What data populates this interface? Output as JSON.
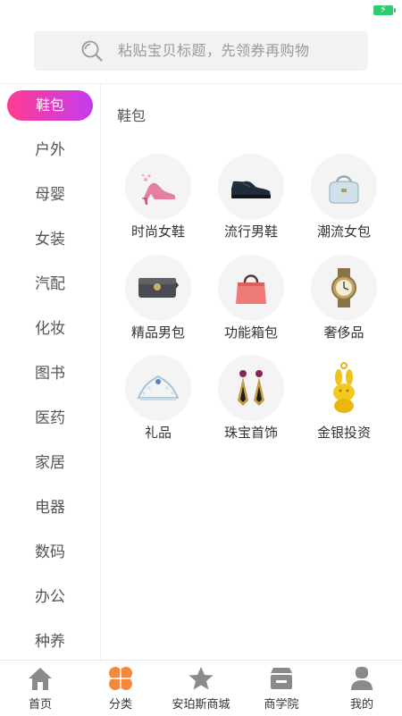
{
  "search": {
    "placeholder": "粘贴宝贝标题，先领券再购物"
  },
  "sidebar": {
    "items": [
      {
        "label": "鞋包",
        "active": true
      },
      {
        "label": "户外"
      },
      {
        "label": "母婴"
      },
      {
        "label": "女装"
      },
      {
        "label": "汽配"
      },
      {
        "label": "化妆"
      },
      {
        "label": "图书"
      },
      {
        "label": "医药"
      },
      {
        "label": "家居"
      },
      {
        "label": "电器"
      },
      {
        "label": "数码"
      },
      {
        "label": "办公"
      },
      {
        "label": "种养"
      }
    ]
  },
  "main": {
    "title": "鞋包",
    "categories": [
      {
        "label": "时尚女鞋",
        "icon": "high-heel-icon"
      },
      {
        "label": "流行男鞋",
        "icon": "mens-shoe-icon"
      },
      {
        "label": "潮流女包",
        "icon": "handbag-icon"
      },
      {
        "label": "精品男包",
        "icon": "wallet-icon"
      },
      {
        "label": "功能箱包",
        "icon": "tote-bag-icon"
      },
      {
        "label": "奢侈品",
        "icon": "watch-icon"
      },
      {
        "label": "礼品",
        "icon": "tiara-icon"
      },
      {
        "label": "珠宝首饰",
        "icon": "earrings-icon"
      },
      {
        "label": "金银投资",
        "icon": "gold-rabbit-icon"
      }
    ]
  },
  "bottom_nav": {
    "items": [
      {
        "label": "首页",
        "icon": "home-icon"
      },
      {
        "label": "分类",
        "icon": "category-icon",
        "active": true
      },
      {
        "label": "安珀斯商城",
        "icon": "star-icon"
      },
      {
        "label": "商学院",
        "icon": "store-icon"
      },
      {
        "label": "我的",
        "icon": "user-icon"
      }
    ]
  },
  "colors": {
    "accent_start": "#ff3d8f",
    "accent_end": "#c53bf0",
    "category_active": "#f5883b",
    "nav_inactive": "#8a8a8a",
    "battery": "#2ecc71"
  }
}
